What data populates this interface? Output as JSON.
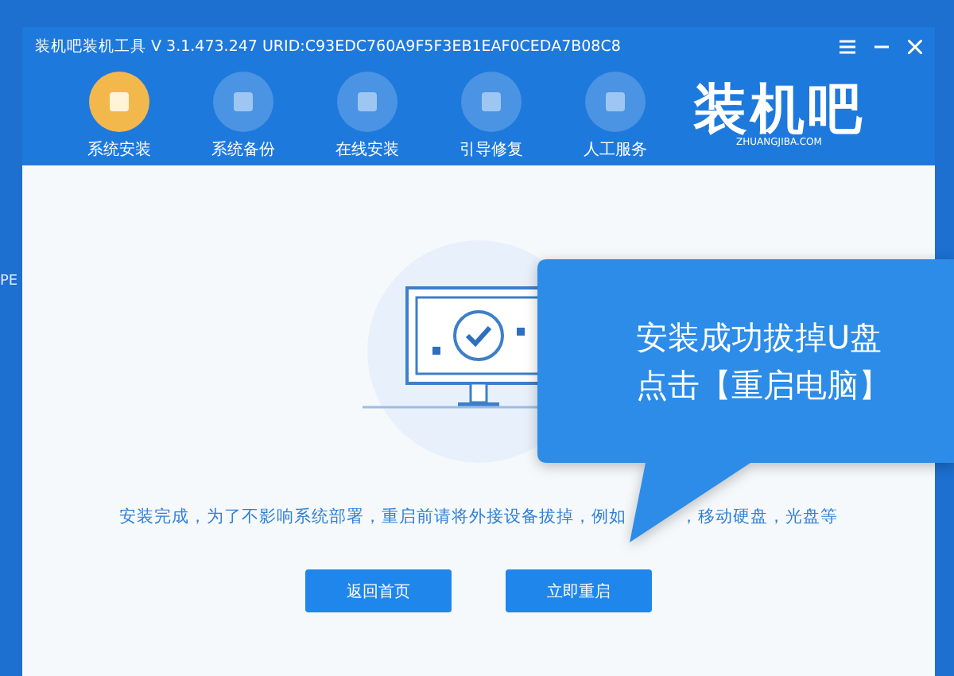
{
  "desktop": {
    "fragment": "PE"
  },
  "window": {
    "title": "装机吧装机工具 V 3.1.473.247 URID:C93EDC760A9F5F3EB1EAF0CEDA7B08C8"
  },
  "nav": [
    {
      "label": "系统安装",
      "selected": true
    },
    {
      "label": "系统备份",
      "selected": false
    },
    {
      "label": "在线安装",
      "selected": false
    },
    {
      "label": "引导修复",
      "selected": false
    },
    {
      "label": "人工服务",
      "selected": false
    }
  ],
  "logo": {
    "name": "装机吧",
    "site": "ZHUANGJIBA.COM"
  },
  "message": {
    "before": "安装完成，为了不影响系统部署，重启前请将外接设备拔掉，例如",
    "after": "，移动硬盘，光盘等"
  },
  "buttons": [
    "返回首页",
    "立即重启"
  ],
  "callout": {
    "lines": [
      "安装成功拔掉U盘",
      "点击【重启电脑】"
    ]
  }
}
